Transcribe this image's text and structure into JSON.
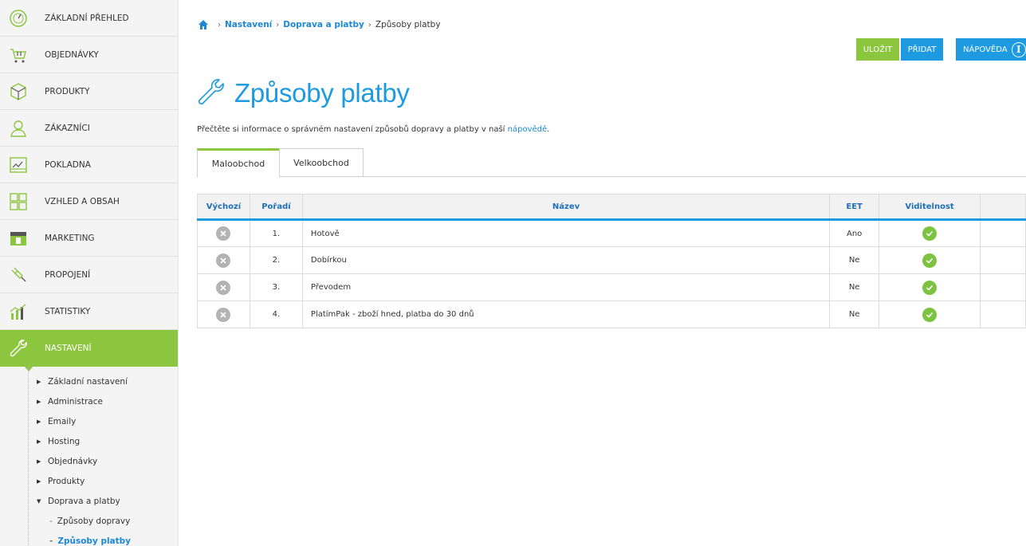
{
  "sidebar": {
    "items": [
      {
        "label": "ZÁKLADNÍ PŘEHLED",
        "icon": "dashboard-icon"
      },
      {
        "label": "OBJEDNÁVKY",
        "icon": "cart-icon"
      },
      {
        "label": "PRODUKTY",
        "icon": "box-icon"
      },
      {
        "label": "ZÁKAZNÍCI",
        "icon": "user-icon"
      },
      {
        "label": "POKLADNA",
        "icon": "cash-register-icon"
      },
      {
        "label": "VZHLED A OBSAH",
        "icon": "layout-icon"
      },
      {
        "label": "MARKETING",
        "icon": "marketing-icon"
      },
      {
        "label": "PROPOJENÍ",
        "icon": "plug-icon"
      },
      {
        "label": "STATISTIKY",
        "icon": "chart-icon"
      },
      {
        "label": "NASTAVENÍ",
        "icon": "wrench-icon"
      }
    ],
    "submenu": [
      "Základní nastavení",
      "Administrace",
      "Emaily",
      "Hosting",
      "Objednávky",
      "Produkty",
      "Doprava a platby"
    ],
    "subsubmenu": [
      "Způsoby dopravy",
      "Způsoby platby"
    ]
  },
  "breadcrumb": {
    "link1": "Nastavení",
    "link2": "Doprava a platby",
    "current": "Způsoby platby"
  },
  "toolbar": {
    "save_label": "ULOŽIT",
    "add_label": "PŘIDAT",
    "help_label": "NÁPOVĚDA"
  },
  "page": {
    "title": "Způsoby platby",
    "info_text": "Přečtěte si informace o správném nastavení způsobů dopravy a platby v naší ",
    "info_link": "nápovědě",
    "info_end": "."
  },
  "tabs": [
    "Maloobchod",
    "Velkoobchod"
  ],
  "table": {
    "headers": [
      "Výchozí",
      "Pořadí",
      "Název",
      "EET",
      "Viditelnost",
      ""
    ],
    "rows": [
      {
        "order": "1.",
        "name": "Hotově",
        "eet": "Ano"
      },
      {
        "order": "2.",
        "name": "Dobírkou",
        "eet": "Ne"
      },
      {
        "order": "3.",
        "name": "Převodem",
        "eet": "Ne"
      },
      {
        "order": "4.",
        "name": "PlatímPak - zboží hned, platba do 30 dnů",
        "eet": "Ne"
      }
    ]
  },
  "colors": {
    "accent_green": "#8cc63f",
    "accent_blue": "#1e9be0"
  }
}
